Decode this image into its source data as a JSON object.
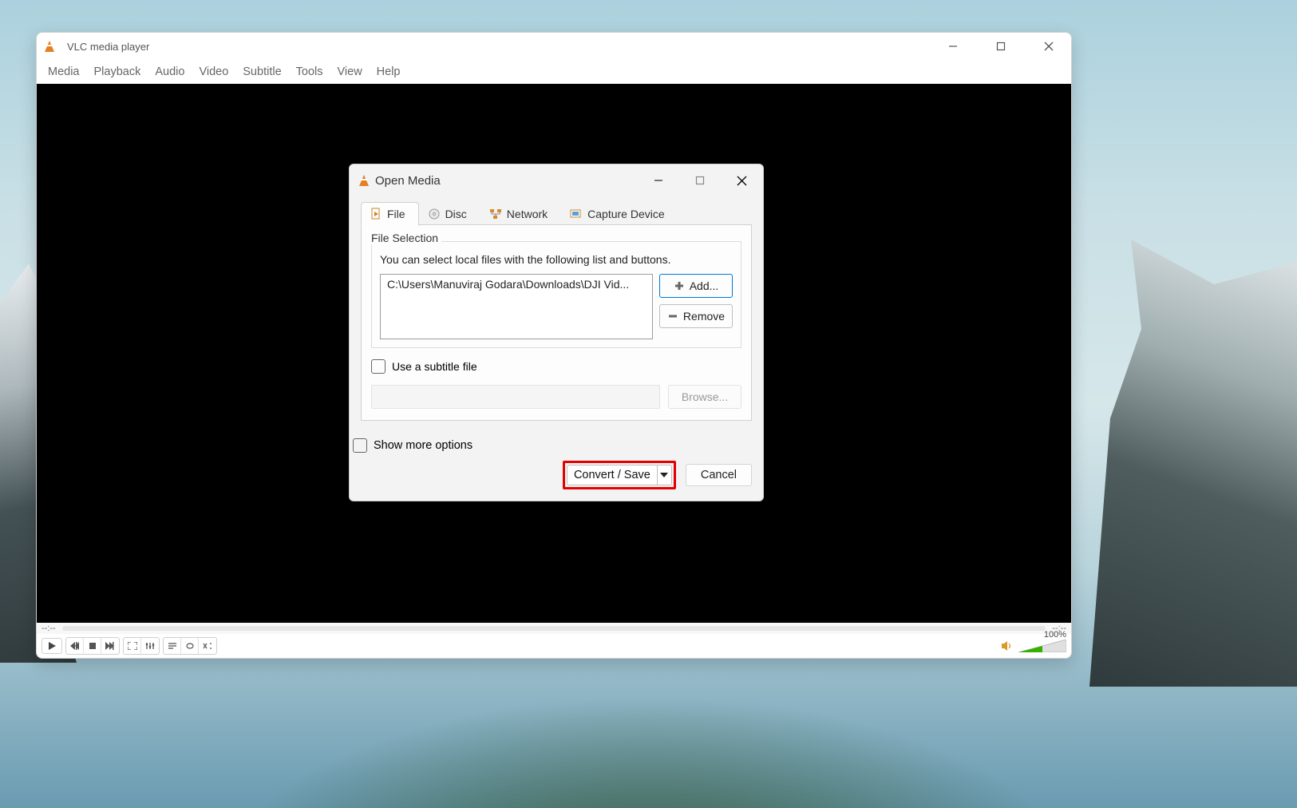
{
  "main_window": {
    "title": "VLC media player",
    "menus": [
      "Media",
      "Playback",
      "Audio",
      "Video",
      "Subtitle",
      "Tools",
      "View",
      "Help"
    ],
    "time_left": "--:--",
    "time_right": "--:--",
    "volume_pct": "100%"
  },
  "dialog": {
    "title": "Open Media",
    "tabs": {
      "file": "File",
      "disc": "Disc",
      "network": "Network",
      "capture": "Capture Device"
    },
    "file_selection": {
      "legend": "File Selection",
      "description": "You can select local files with the following list and buttons.",
      "files": [
        "C:\\Users\\Manuviraj Godara\\Downloads\\DJI Vid..."
      ],
      "add_label": "Add...",
      "remove_label": "Remove"
    },
    "subtitle": {
      "checkbox_label": "Use a subtitle file",
      "browse_label": "Browse..."
    },
    "show_more_label": "Show more options",
    "convert_label": "Convert / Save",
    "cancel_label": "Cancel"
  }
}
